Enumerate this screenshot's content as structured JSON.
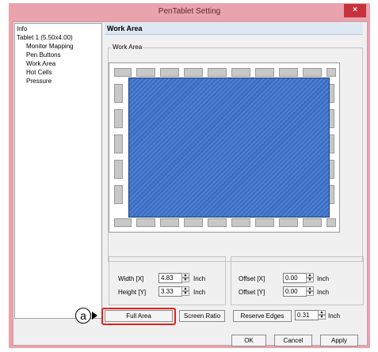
{
  "window": {
    "title": "PenTablet Setting",
    "close_glyph": "×"
  },
  "tree": {
    "items": [
      {
        "label": "Info"
      },
      {
        "label": "Tablet  1 (5.50x4.00)"
      },
      {
        "label": "Monitor Mapping"
      },
      {
        "label": "Pen Buttons"
      },
      {
        "label": "Work Area",
        "selected": true
      },
      {
        "label": "Hot Cells"
      },
      {
        "label": "Pressure"
      }
    ]
  },
  "section": {
    "title": "Work Area",
    "group_label": "Work Area"
  },
  "size": {
    "width_label": "Width [X]",
    "width_value": "4.83",
    "width_unit": "Inch",
    "height_label": "Height [Y]",
    "height_value": "3.33",
    "height_unit": "Inch"
  },
  "offset": {
    "x_label": "Offset [X]",
    "x_value": "0.00",
    "x_unit": "Inch",
    "y_label": "Offset [Y]",
    "y_value": "0.00",
    "y_unit": "Inch"
  },
  "buttons": {
    "full_area": "Full Area",
    "screen_ratio": "Screen Ratio",
    "reserve_edges": "Reserve Edges",
    "reserve_value": "0.31",
    "reserve_unit": "Inch",
    "ok": "OK",
    "cancel": "Cancel",
    "apply": "Apply"
  },
  "annotation": {
    "callout_letter": "a"
  },
  "colors": {
    "work_area_fill": "#3a70c6",
    "titlebar": "#eaa2ac",
    "close": "#c8323c",
    "highlight": "#e02020"
  }
}
